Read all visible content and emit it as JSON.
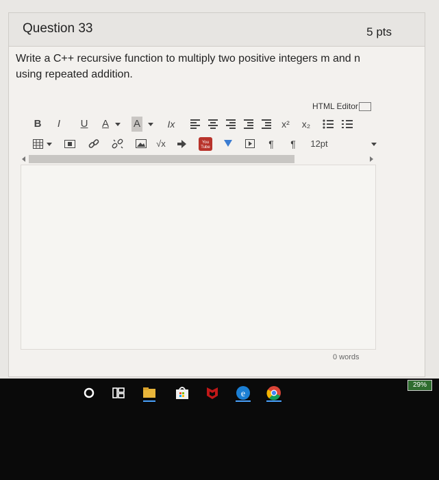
{
  "question": {
    "title": "Question 33",
    "points": "5 pts",
    "text": "Write a C++ recursive function to multiply two positive integers m and n using repeated addition."
  },
  "editor": {
    "html_editor_label": "HTML Editor",
    "font_size": "12pt",
    "word_count": "0 words",
    "toolbar1": [
      "B",
      "I",
      "U",
      "A",
      "A",
      "Ix",
      "x²",
      "x₂"
    ],
    "toolbar2": [
      "√x",
      "¶",
      "¶"
    ]
  },
  "taskbar": {
    "battery": "29%",
    "icons": [
      "cortana-icon",
      "task-view-icon",
      "file-explorer-icon",
      "store-icon",
      "mcafee-icon",
      "edge-icon",
      "chrome-icon"
    ]
  }
}
